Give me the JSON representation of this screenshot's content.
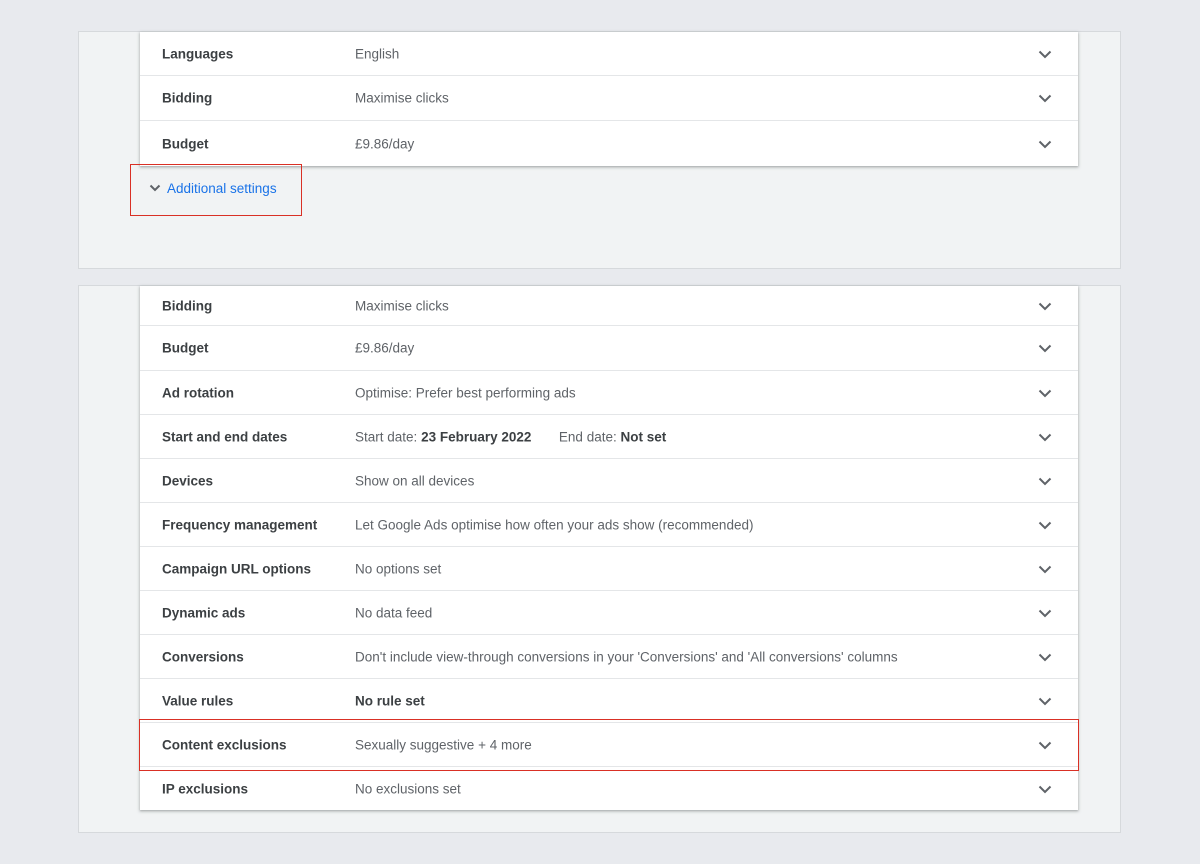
{
  "panel_top": {
    "rows": [
      {
        "label": "Languages",
        "value": "English"
      },
      {
        "label": "Bidding",
        "value": "Maximise clicks"
      },
      {
        "label": "Budget",
        "value": "£9.86/day"
      }
    ],
    "additional_settings_link": "Additional settings"
  },
  "panel_bottom": {
    "rows": [
      {
        "label": "Bidding",
        "value": "Maximise clicks"
      },
      {
        "label": "Budget",
        "value": "£9.86/day"
      },
      {
        "label": "Ad rotation",
        "value": "Optimise: Prefer best performing ads"
      },
      {
        "label": "Start and end dates",
        "start_prefix": "Start date:",
        "start_value": "23 February 2022",
        "end_prefix": "End date:",
        "end_value": "Not set"
      },
      {
        "label": "Devices",
        "value": "Show on all devices"
      },
      {
        "label": "Frequency management",
        "value": "Let Google Ads optimise how often your ads show (recommended)"
      },
      {
        "label": "Campaign URL options",
        "value": "No options set"
      },
      {
        "label": "Dynamic ads",
        "value": "No data feed"
      },
      {
        "label": "Conversions",
        "value": "Don't include view-through conversions in your 'Conversions' and 'All conversions' columns"
      },
      {
        "label": "Value rules",
        "value": "No rule set"
      },
      {
        "label": "Content exclusions",
        "value": "Sexually suggestive + 4 more"
      },
      {
        "label": "IP exclusions",
        "value": "No exclusions set"
      }
    ]
  },
  "icons": {
    "expand": "chevron-down-icon",
    "link_expand": "chevron-down-icon"
  },
  "colors": {
    "link": "#1a73e8",
    "highlight": "#d93025",
    "background": "#e8eaee",
    "panel": "#f1f3f4"
  }
}
